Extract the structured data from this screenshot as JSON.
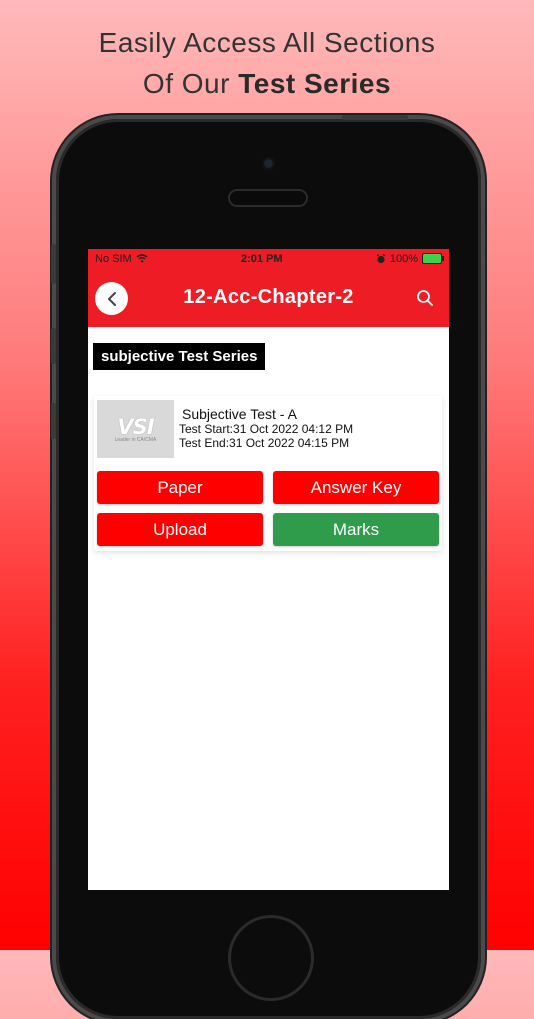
{
  "headline": {
    "line1": "Easily Access All Sections",
    "line2_plain": "Of Our ",
    "line2_bold": "Test Series"
  },
  "status_bar": {
    "carrier": "No SIM",
    "time": "2:01 PM",
    "battery": "100%"
  },
  "nav": {
    "title": "12-Acc-Chapter-2",
    "back_icon": "chevron-left-icon",
    "search_icon": "search-icon"
  },
  "section_label": "subjective Test Series",
  "test_card": {
    "thumbnail_alt": "VSI",
    "thumbnail_sub": "Leader in CA/CMA",
    "title": "Subjective Test - A",
    "start": "Test Start:31 Oct 2022 04:12 PM",
    "end": "Test End:31 Oct 2022 04:15 PM",
    "buttons": {
      "paper": "Paper",
      "answer_key": "Answer Key",
      "upload": "Upload",
      "marks": "Marks"
    }
  },
  "colors": {
    "accent": "#ee1c25",
    "button_red": "#ff0000",
    "button_green": "#2e9c4a"
  }
}
